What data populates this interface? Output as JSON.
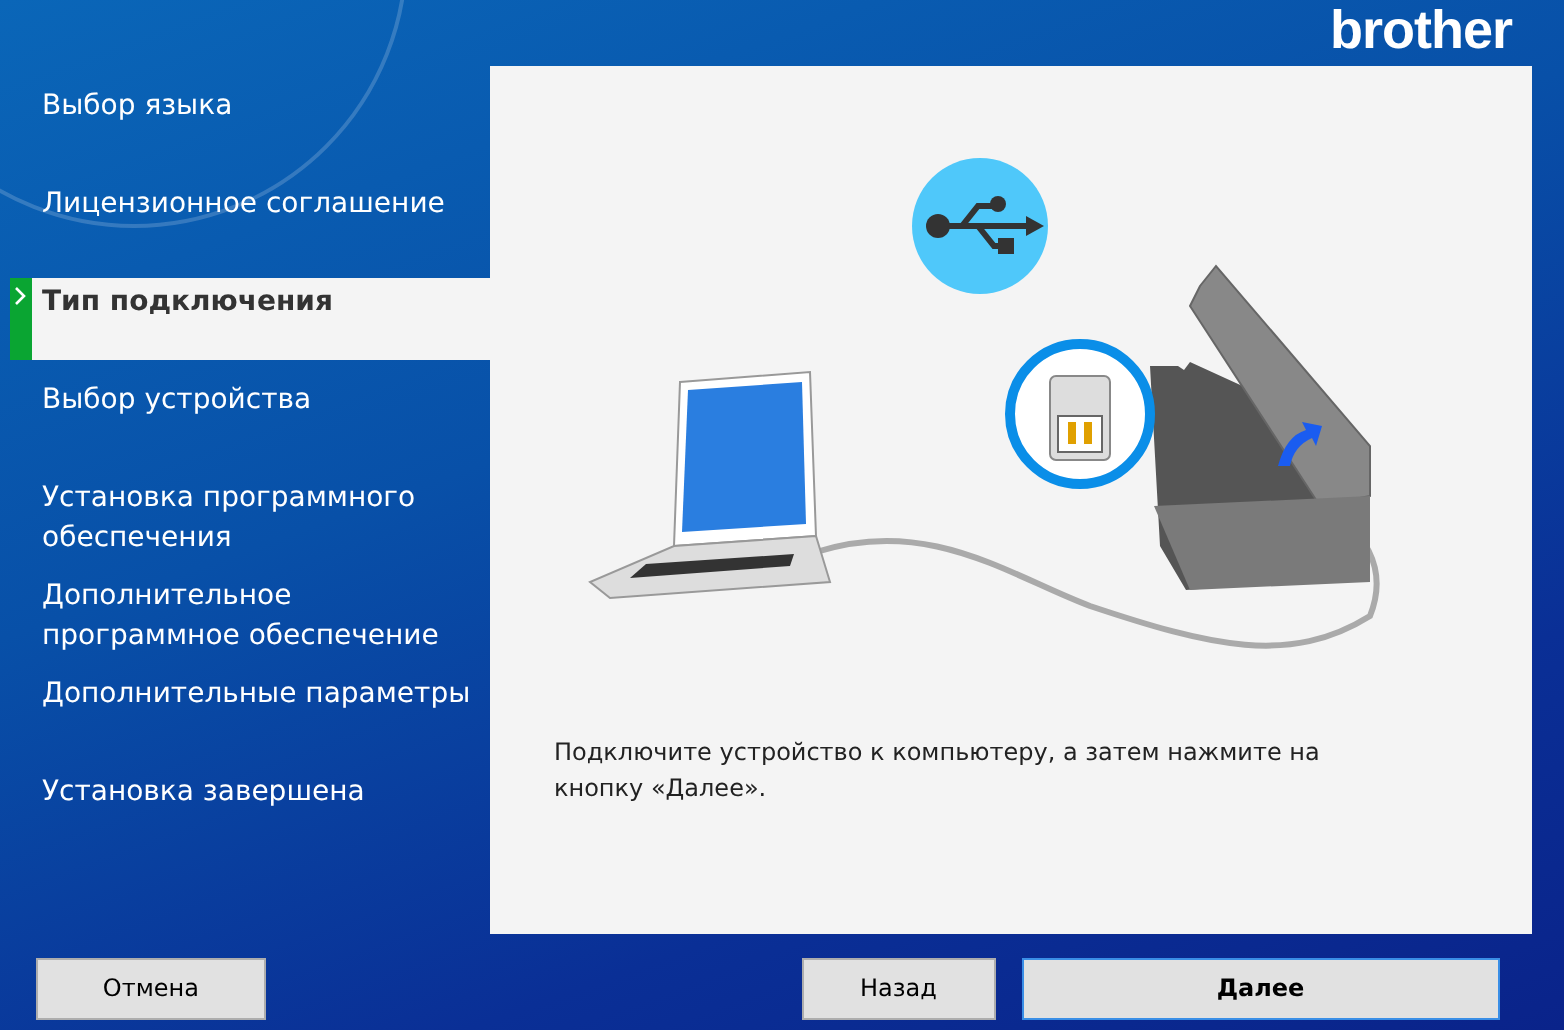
{
  "logo": "brother",
  "steps": [
    {
      "label": "Выбор языка",
      "selected": false
    },
    {
      "label": "Лицензионное соглашение",
      "selected": false
    },
    {
      "label": "Тип подключения",
      "selected": true
    },
    {
      "label": "Выбор устройства",
      "selected": false
    },
    {
      "label": "Установка программного обеспечения",
      "selected": false
    },
    {
      "label": "Дополнительное программное обеспечение",
      "selected": false
    },
    {
      "label": "Дополнительные параметры",
      "selected": false
    },
    {
      "label": "Установка завершена",
      "selected": false
    }
  ],
  "instruction": "Подключите устройство к компьютеру, а затем нажмите на кнопку «Далее».",
  "buttons": {
    "cancel": "Отмена",
    "back": "Назад",
    "next": "Далее"
  }
}
